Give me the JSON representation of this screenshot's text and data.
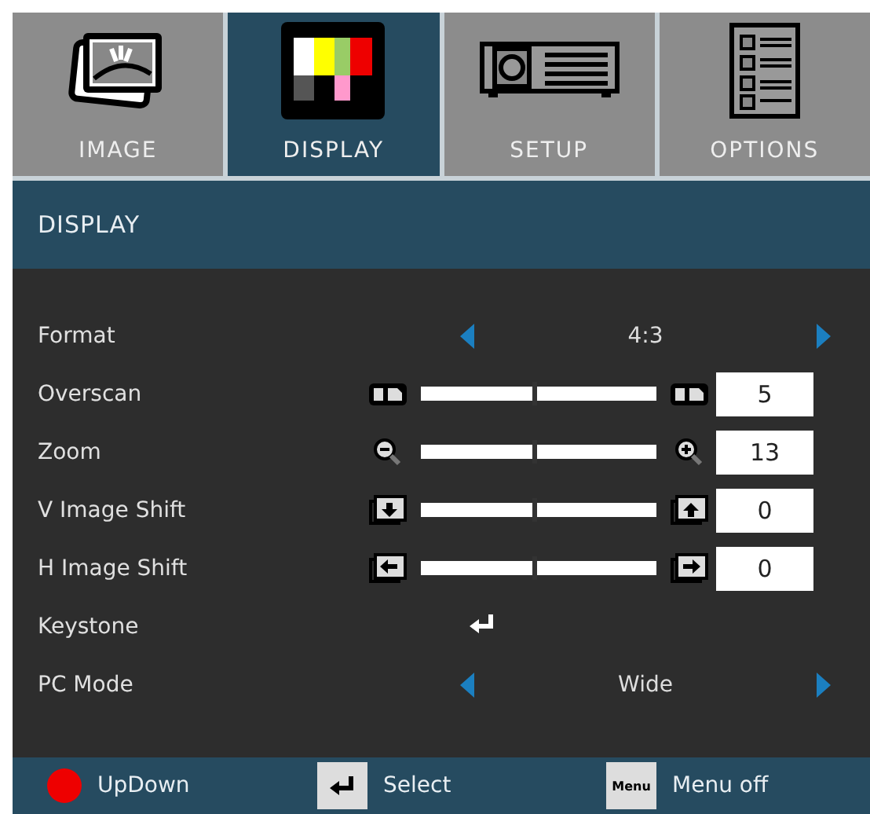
{
  "tabs": [
    {
      "label": "IMAGE",
      "selected": false
    },
    {
      "label": "DISPLAY",
      "selected": true
    },
    {
      "label": "SETUP",
      "selected": false
    },
    {
      "label": "OPTIONS",
      "selected": false
    }
  ],
  "header": {
    "title": "DISPLAY"
  },
  "rows": [
    {
      "kind": "choice",
      "label": "Format",
      "value": "4:3"
    },
    {
      "kind": "slider",
      "label": "Overscan",
      "level": 0.48,
      "value": "5"
    },
    {
      "kind": "slider",
      "label": "Zoom",
      "level": 0.48,
      "value": "13"
    },
    {
      "kind": "slider",
      "label": "V Image Shift",
      "level": 0.48,
      "value": "0"
    },
    {
      "kind": "slider",
      "label": "H Image Shift",
      "level": 0.48,
      "value": "0"
    },
    {
      "kind": "enter",
      "label": "Keystone"
    },
    {
      "kind": "choice",
      "label": "PC Mode",
      "value": "Wide"
    }
  ],
  "footer": [
    {
      "label": "UpDown"
    },
    {
      "label": "Select"
    },
    {
      "key": "Menu",
      "label": "Menu off"
    }
  ]
}
